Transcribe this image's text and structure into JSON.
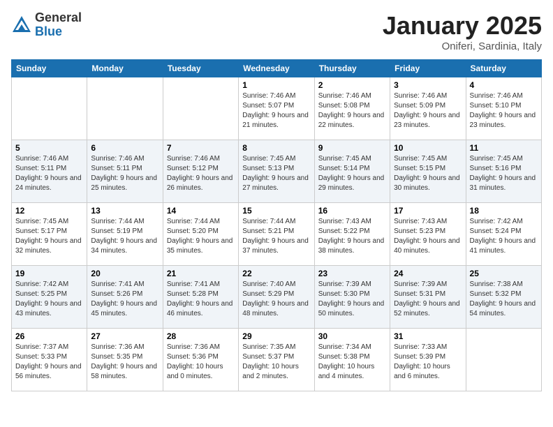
{
  "logo": {
    "general": "General",
    "blue": "Blue"
  },
  "title": "January 2025",
  "location": "Oniferi, Sardinia, Italy",
  "weekdays": [
    "Sunday",
    "Monday",
    "Tuesday",
    "Wednesday",
    "Thursday",
    "Friday",
    "Saturday"
  ],
  "weeks": [
    [
      {
        "day": "",
        "info": ""
      },
      {
        "day": "",
        "info": ""
      },
      {
        "day": "",
        "info": ""
      },
      {
        "day": "1",
        "info": "Sunrise: 7:46 AM\nSunset: 5:07 PM\nDaylight: 9 hours and 21 minutes."
      },
      {
        "day": "2",
        "info": "Sunrise: 7:46 AM\nSunset: 5:08 PM\nDaylight: 9 hours and 22 minutes."
      },
      {
        "day": "3",
        "info": "Sunrise: 7:46 AM\nSunset: 5:09 PM\nDaylight: 9 hours and 23 minutes."
      },
      {
        "day": "4",
        "info": "Sunrise: 7:46 AM\nSunset: 5:10 PM\nDaylight: 9 hours and 23 minutes."
      }
    ],
    [
      {
        "day": "5",
        "info": "Sunrise: 7:46 AM\nSunset: 5:11 PM\nDaylight: 9 hours and 24 minutes."
      },
      {
        "day": "6",
        "info": "Sunrise: 7:46 AM\nSunset: 5:11 PM\nDaylight: 9 hours and 25 minutes."
      },
      {
        "day": "7",
        "info": "Sunrise: 7:46 AM\nSunset: 5:12 PM\nDaylight: 9 hours and 26 minutes."
      },
      {
        "day": "8",
        "info": "Sunrise: 7:45 AM\nSunset: 5:13 PM\nDaylight: 9 hours and 27 minutes."
      },
      {
        "day": "9",
        "info": "Sunrise: 7:45 AM\nSunset: 5:14 PM\nDaylight: 9 hours and 29 minutes."
      },
      {
        "day": "10",
        "info": "Sunrise: 7:45 AM\nSunset: 5:15 PM\nDaylight: 9 hours and 30 minutes."
      },
      {
        "day": "11",
        "info": "Sunrise: 7:45 AM\nSunset: 5:16 PM\nDaylight: 9 hours and 31 minutes."
      }
    ],
    [
      {
        "day": "12",
        "info": "Sunrise: 7:45 AM\nSunset: 5:17 PM\nDaylight: 9 hours and 32 minutes."
      },
      {
        "day": "13",
        "info": "Sunrise: 7:44 AM\nSunset: 5:19 PM\nDaylight: 9 hours and 34 minutes."
      },
      {
        "day": "14",
        "info": "Sunrise: 7:44 AM\nSunset: 5:20 PM\nDaylight: 9 hours and 35 minutes."
      },
      {
        "day": "15",
        "info": "Sunrise: 7:44 AM\nSunset: 5:21 PM\nDaylight: 9 hours and 37 minutes."
      },
      {
        "day": "16",
        "info": "Sunrise: 7:43 AM\nSunset: 5:22 PM\nDaylight: 9 hours and 38 minutes."
      },
      {
        "day": "17",
        "info": "Sunrise: 7:43 AM\nSunset: 5:23 PM\nDaylight: 9 hours and 40 minutes."
      },
      {
        "day": "18",
        "info": "Sunrise: 7:42 AM\nSunset: 5:24 PM\nDaylight: 9 hours and 41 minutes."
      }
    ],
    [
      {
        "day": "19",
        "info": "Sunrise: 7:42 AM\nSunset: 5:25 PM\nDaylight: 9 hours and 43 minutes."
      },
      {
        "day": "20",
        "info": "Sunrise: 7:41 AM\nSunset: 5:26 PM\nDaylight: 9 hours and 45 minutes."
      },
      {
        "day": "21",
        "info": "Sunrise: 7:41 AM\nSunset: 5:28 PM\nDaylight: 9 hours and 46 minutes."
      },
      {
        "day": "22",
        "info": "Sunrise: 7:40 AM\nSunset: 5:29 PM\nDaylight: 9 hours and 48 minutes."
      },
      {
        "day": "23",
        "info": "Sunrise: 7:39 AM\nSunset: 5:30 PM\nDaylight: 9 hours and 50 minutes."
      },
      {
        "day": "24",
        "info": "Sunrise: 7:39 AM\nSunset: 5:31 PM\nDaylight: 9 hours and 52 minutes."
      },
      {
        "day": "25",
        "info": "Sunrise: 7:38 AM\nSunset: 5:32 PM\nDaylight: 9 hours and 54 minutes."
      }
    ],
    [
      {
        "day": "26",
        "info": "Sunrise: 7:37 AM\nSunset: 5:33 PM\nDaylight: 9 hours and 56 minutes."
      },
      {
        "day": "27",
        "info": "Sunrise: 7:36 AM\nSunset: 5:35 PM\nDaylight: 9 hours and 58 minutes."
      },
      {
        "day": "28",
        "info": "Sunrise: 7:36 AM\nSunset: 5:36 PM\nDaylight: 10 hours and 0 minutes."
      },
      {
        "day": "29",
        "info": "Sunrise: 7:35 AM\nSunset: 5:37 PM\nDaylight: 10 hours and 2 minutes."
      },
      {
        "day": "30",
        "info": "Sunrise: 7:34 AM\nSunset: 5:38 PM\nDaylight: 10 hours and 4 minutes."
      },
      {
        "day": "31",
        "info": "Sunrise: 7:33 AM\nSunset: 5:39 PM\nDaylight: 10 hours and 6 minutes."
      },
      {
        "day": "",
        "info": ""
      }
    ]
  ]
}
